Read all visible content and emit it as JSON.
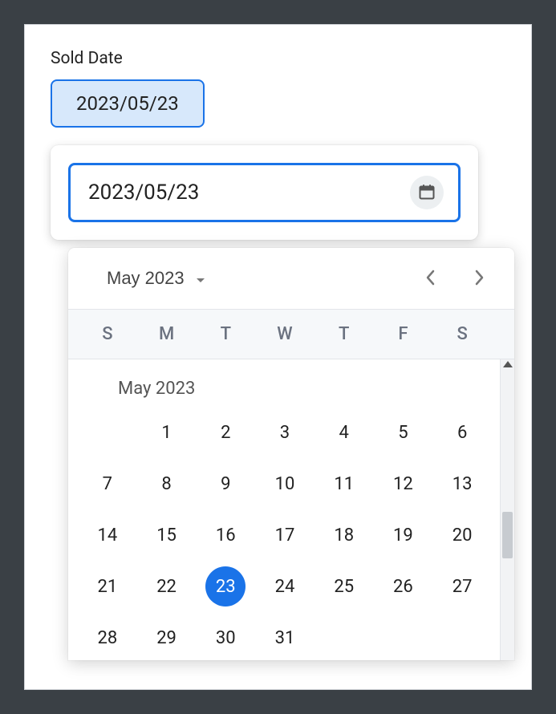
{
  "field": {
    "label": "Sold Date",
    "chip_value": "2023/05/23"
  },
  "input": {
    "value": "2023/05/23"
  },
  "calendar": {
    "header_month": "May 2023",
    "weekdays": [
      "S",
      "M",
      "T",
      "W",
      "T",
      "F",
      "S"
    ],
    "body_month_label": "May 2023",
    "blanks_before": 1,
    "days_in_month": 31,
    "selected_day": 23
  }
}
